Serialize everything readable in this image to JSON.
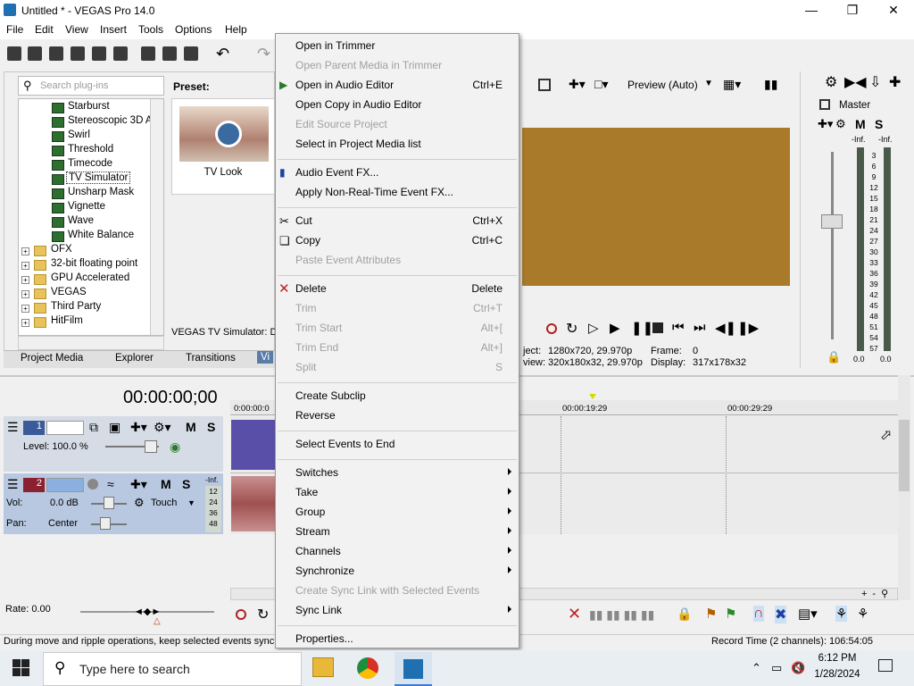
{
  "window": {
    "title": "Untitled * - VEGAS Pro 14.0"
  },
  "menubar": [
    "File",
    "Edit",
    "View",
    "Insert",
    "Tools",
    "Options",
    "Help"
  ],
  "plugins": {
    "search_placeholder": "Search plug-ins",
    "preset_label": "Preset:",
    "preset_name": "TV Look",
    "preset_footer": "VEGAS TV Simulator: DX",
    "fx_items": [
      "Starburst",
      "Stereoscopic 3D Ac",
      "Swirl",
      "Threshold",
      "Timecode",
      "TV Simulator",
      "Unsharp Mask",
      "Vignette",
      "Wave",
      "White Balance"
    ],
    "folders": [
      "OFX",
      "32-bit floating point",
      "GPU Accelerated",
      "VEGAS",
      "Third Party",
      "HitFilm"
    ],
    "selected": "TV Simulator"
  },
  "tabs": [
    "Project Media",
    "Explorer",
    "Transitions",
    "Vi"
  ],
  "preview": {
    "mode": "Preview (Auto)",
    "project_label": "ject:",
    "project_value": "1280x720, 29.970p",
    "preview_label": "view:",
    "preview_value": "320x180x32, 29.970p",
    "frame_label": "Frame:",
    "frame_value": "0",
    "display_label": "Display:",
    "display_value": "317x178x32"
  },
  "mixer": {
    "title": "Master",
    "peak_left": "-Inf.",
    "peak_right": "-Inf.",
    "scale": [
      "3",
      "6",
      "9",
      "12",
      "15",
      "18",
      "21",
      "24",
      "27",
      "30",
      "33",
      "36",
      "39",
      "42",
      "45",
      "48",
      "51",
      "54",
      "57"
    ],
    "bottom_left": "0.0",
    "bottom_right": "0.0"
  },
  "timeline": {
    "timecode": "00:00:00;00",
    "ruler": [
      "0:00:00:0",
      "00:00:19:29",
      "00:00:29:29"
    ],
    "rate": "Rate: 0.00",
    "record_time": "Record Time (2 channels): 106:54:05"
  },
  "tracks": {
    "video": {
      "number": "1",
      "level": "Level: 100.0 %"
    },
    "audio": {
      "number": "2",
      "vol_label": "Vol:",
      "vol_value": "0.0 dB",
      "pan_label": "Pan:",
      "pan_value": "Center",
      "touch": "Touch",
      "meter_top": "-Inf.",
      "meter_scale": [
        "12",
        "24",
        "36",
        "48"
      ]
    }
  },
  "status": "During move and ripple operations, keep selected events synch",
  "context_menu": [
    {
      "label": "Open in Trimmer",
      "enabled": true
    },
    {
      "label": "Open Parent Media in Trimmer",
      "enabled": false
    },
    {
      "label": "Open in Audio Editor",
      "shortcut": "Ctrl+E",
      "enabled": true
    },
    {
      "label": "Open Copy in Audio Editor",
      "enabled": true
    },
    {
      "label": "Edit Source Project",
      "enabled": false
    },
    {
      "label": "Select in Project Media list",
      "enabled": true
    },
    {
      "label": "Audio Event FX...",
      "enabled": true
    },
    {
      "label": "Apply Non-Real-Time Event FX...",
      "enabled": true
    },
    {
      "label": "Cut",
      "shortcut": "Ctrl+X",
      "enabled": true
    },
    {
      "label": "Copy",
      "shortcut": "Ctrl+C",
      "enabled": true
    },
    {
      "label": "Paste Event Attributes",
      "enabled": false
    },
    {
      "label": "Delete",
      "shortcut": "Delete",
      "enabled": true
    },
    {
      "label": "Trim",
      "shortcut": "Ctrl+T",
      "enabled": false
    },
    {
      "label": "Trim Start",
      "shortcut": "Alt+[",
      "enabled": false
    },
    {
      "label": "Trim End",
      "shortcut": "Alt+]",
      "enabled": false
    },
    {
      "label": "Split",
      "shortcut": "S",
      "enabled": false
    },
    {
      "label": "Create Subclip",
      "enabled": true
    },
    {
      "label": "Reverse",
      "enabled": true
    },
    {
      "label": "Select Events to End",
      "enabled": true
    },
    {
      "label": "Switches",
      "submenu": true,
      "enabled": true
    },
    {
      "label": "Take",
      "submenu": true,
      "enabled": true
    },
    {
      "label": "Group",
      "submenu": true,
      "enabled": true
    },
    {
      "label": "Stream",
      "submenu": true,
      "enabled": true
    },
    {
      "label": "Channels",
      "submenu": true,
      "enabled": true
    },
    {
      "label": "Synchronize",
      "submenu": true,
      "enabled": true
    },
    {
      "label": "Create Sync Link with Selected Events",
      "enabled": false
    },
    {
      "label": "Sync Link",
      "submenu": true,
      "enabled": true
    },
    {
      "label": "Properties...",
      "enabled": true
    }
  ],
  "taskbar": {
    "search_placeholder": "Type here to search",
    "time": "6:12 PM",
    "date": "1/28/2024"
  }
}
